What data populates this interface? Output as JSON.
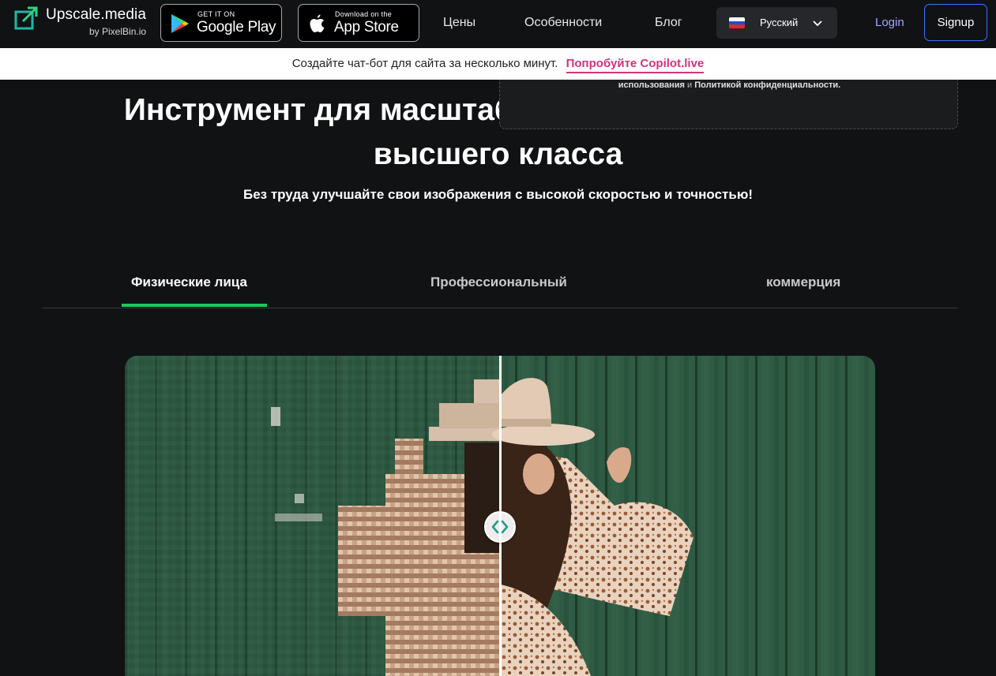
{
  "nav": {
    "logo_name": "Upscale",
    "logo_name_suffix": "media",
    "logo_sub": "by PixelBin.io",
    "google_play": {
      "small": "GET IT ON",
      "big": "Google Play"
    },
    "app_store": {
      "small": "Download on the",
      "big": "App Store"
    },
    "links": [
      "Цены",
      "Особенности",
      "Блог"
    ],
    "language": "Русский",
    "login": "Login",
    "signup": "Signup"
  },
  "banner": {
    "text": "Создайте чат-бот для сайта за несколько минут.",
    "link": "Попробуйте Copilot.live"
  },
  "dashbox": {
    "part1": "использования",
    "joiner": "и",
    "part2": "Политикой конфиденциальности."
  },
  "hero": {
    "title_line1": "Инструмент для масштабирования изображений",
    "title_line2": "высшего класса",
    "subtitle": "Без труда улучшайте свои изображения с высокой скоростью и точностью!"
  },
  "tabs": [
    {
      "label": "Физические лица",
      "active": true
    },
    {
      "label": "Профессиональный",
      "active": false
    },
    {
      "label": "коммерция",
      "active": false
    }
  ],
  "colors": {
    "background": "#111214",
    "accent_green": "#22c55e",
    "banner_link": "#d6327a",
    "signup_border": "#3a72ff",
    "login": "#a3a8ff"
  },
  "icons": {
    "logo": "upscale-logo-icon",
    "google_play": "google-play-icon",
    "app_store": "apple-icon",
    "flag": "russia-flag-icon",
    "chevron": "chevron-down-icon",
    "handle": "compare-arrows-icon"
  }
}
